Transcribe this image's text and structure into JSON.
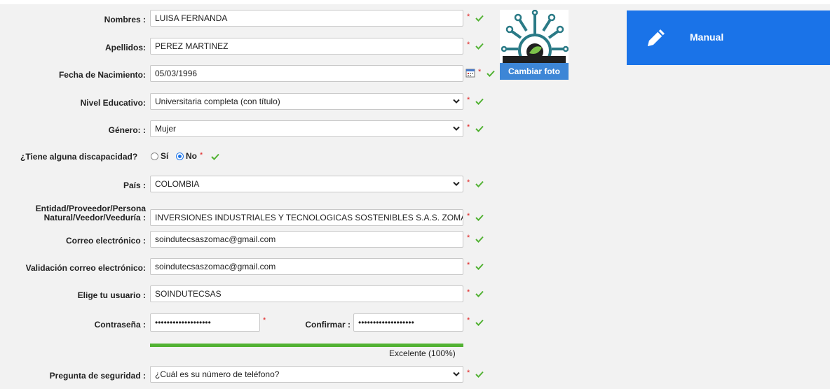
{
  "form": {
    "nombres": {
      "label": "Nombres :",
      "value": "LUISA FERNANDA"
    },
    "apellidos": {
      "label": "Apellidos:",
      "value": "PEREZ MARTINEZ"
    },
    "fecha": {
      "label": "Fecha de Nacimiento:",
      "value": "05/03/1996",
      "icon": "calendar-icon"
    },
    "nivel": {
      "label": "Nivel Educativo:",
      "value": "Universitaria completa (con título)"
    },
    "genero": {
      "label": "Género: :",
      "value": "Mujer"
    },
    "discapacidad": {
      "label": "¿Tiene alguna discapacidad?",
      "options": [
        "Sí",
        "No"
      ],
      "selected": "No"
    },
    "pais": {
      "label": "País :",
      "value": "COLOMBIA"
    },
    "entidad": {
      "label_line1": "Entidad/Proveedor/Persona",
      "label_line2": "Natural/Veedor/Veeduría :",
      "value": "INVERSIONES INDUSTRIALES Y TECNOLOGICAS SOSTENIBLES S.A.S. ZOMA"
    },
    "correo": {
      "label": "Correo electrónico :",
      "value": "soindutecsaszomac@gmail.com"
    },
    "validacion": {
      "label": "Validación correo electrónico:",
      "value": "soindutecsaszomac@gmail.com"
    },
    "usuario": {
      "label": "Elige tu usuario :",
      "value": "SOINDUTECSAS"
    },
    "contrasena": {
      "label": "Contraseña :",
      "value": "•••••••••••••••••••"
    },
    "confirmar": {
      "label": "Confirmar :",
      "value": "•••••••••••••••••••"
    },
    "strength": {
      "text": "Excelente (100%)",
      "level": 1.0
    },
    "pregunta": {
      "label": "Pregunta de seguridad :",
      "value": "¿Cuál es su número de teléfono?"
    },
    "required_mark": "*"
  },
  "photo": {
    "button_label": "Cambiar foto"
  },
  "manual": {
    "label": "Manual",
    "icon": "pencil-icon"
  },
  "colors": {
    "accent": "#1a73e8",
    "check": "#52b233",
    "required": "#e02020",
    "photo_button": "#3d86d6"
  }
}
